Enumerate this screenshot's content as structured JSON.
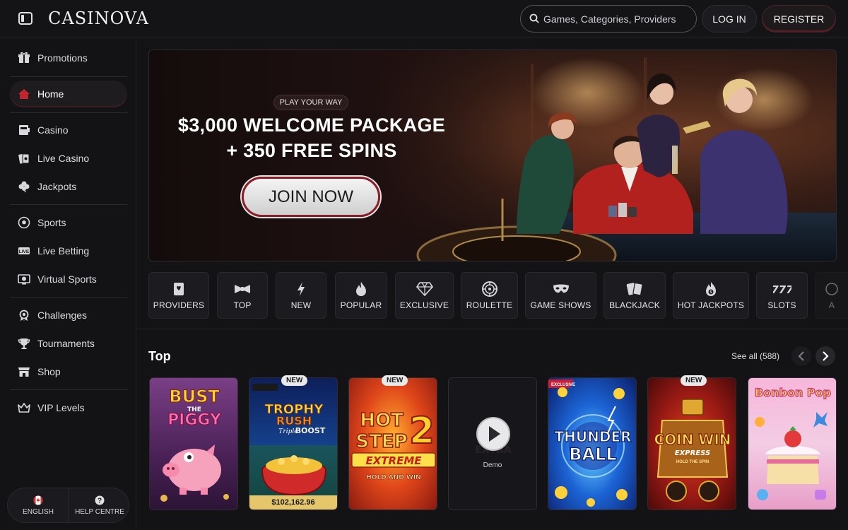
{
  "header": {
    "logo": "CASINOVA",
    "search_placeholder": "Games, Categories, Providers",
    "login_label": "LOG IN",
    "register_label": "REGISTER"
  },
  "sidebar": {
    "items": [
      {
        "label": "Promotions",
        "icon": "gift-icon"
      },
      {
        "label": "Home",
        "icon": "home-icon",
        "active": true
      },
      {
        "label": "Casino",
        "icon": "casino-icon"
      },
      {
        "label": "Live Casino",
        "icon": "live-casino-icon"
      },
      {
        "label": "Jackpots",
        "icon": "clover-icon"
      },
      {
        "label": "Sports",
        "icon": "soccer-ball-icon"
      },
      {
        "label": "Live Betting",
        "icon": "live-badge-icon"
      },
      {
        "label": "Virtual Sports",
        "icon": "virtual-sports-icon"
      },
      {
        "label": "Challenges",
        "icon": "medal-icon"
      },
      {
        "label": "Tournaments",
        "icon": "trophy-icon"
      },
      {
        "label": "Shop",
        "icon": "shop-icon"
      },
      {
        "label": "VIP Levels",
        "icon": "crown-icon"
      }
    ],
    "language_label": "ENGLISH",
    "help_label": "HELP CENTRE"
  },
  "hero": {
    "pill": "PLAY YOUR WAY",
    "title_line1": "$3,000 WELCOME PACKAGE",
    "title_line2": "+ 350 FREE SPINS",
    "cta": "JOIN NOW"
  },
  "categories": [
    {
      "label": "PROVIDERS",
      "icon": "providers-icon"
    },
    {
      "label": "TOP",
      "icon": "bow-tie-icon"
    },
    {
      "label": "NEW",
      "icon": "lightning-icon"
    },
    {
      "label": "POPULAR",
      "icon": "flame-icon"
    },
    {
      "label": "EXCLUSIVE",
      "icon": "diamond-icon"
    },
    {
      "label": "ROULETTE",
      "icon": "roulette-icon"
    },
    {
      "label": "GAME SHOWS",
      "icon": "mask-icon"
    },
    {
      "label": "BLACKJACK",
      "icon": "cards-icon"
    },
    {
      "label": "HOT JACKPOTS",
      "icon": "hot-jackpot-icon"
    },
    {
      "label": "SLOTS",
      "icon": "slots-777-icon"
    },
    {
      "label": "A",
      "icon": "more-icon"
    }
  ],
  "top_section": {
    "title": "Top",
    "see_all": "See all (588)"
  },
  "games": [
    {
      "name": "BUST THE PIGGY",
      "badge": ""
    },
    {
      "name": "TROPHY RUSH Triple BOOST",
      "badge": "NEW",
      "jackpot": "$102,162.96"
    },
    {
      "name": "HOT STEP 2 EXTREME HOLD AND WIN",
      "badge": "NEW"
    },
    {
      "name": "Demo",
      "badge": ""
    },
    {
      "name": "THUNDER BALL",
      "badge": "",
      "tag": "EXCLUSIVE"
    },
    {
      "name": "COIN WIN EXPRESS",
      "badge": "NEW",
      "sub": "HOLD THE SPIN"
    },
    {
      "name": "Bonbon Pop",
      "badge": ""
    }
  ]
}
